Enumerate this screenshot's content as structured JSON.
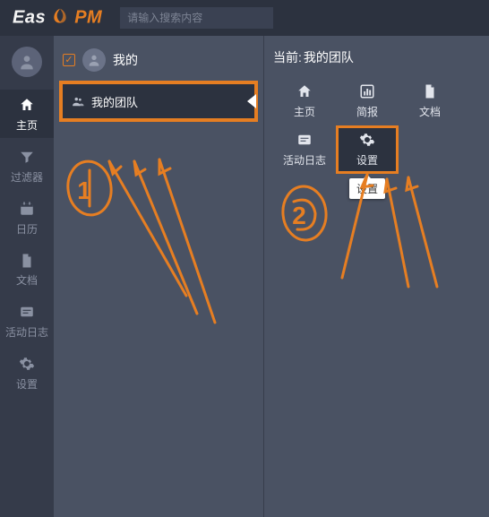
{
  "colors": {
    "accent": "#e67e22"
  },
  "topbar": {
    "logo_text_1": "Eas",
    "logo_text_2": "PM",
    "logo_leaf": "❧"
  },
  "search": {
    "placeholder": "请输入搜索内容"
  },
  "rail": {
    "items": [
      {
        "icon": "home",
        "label": "主页"
      },
      {
        "icon": "filter",
        "label": "过滤器"
      },
      {
        "icon": "calendar",
        "label": "日历"
      },
      {
        "icon": "doc",
        "label": "文档"
      },
      {
        "icon": "log",
        "label": "活动日志"
      },
      {
        "icon": "gear",
        "label": "设置"
      }
    ],
    "active_index": 0
  },
  "mid": {
    "title": "我的",
    "team_item_label": "我的团队"
  },
  "right": {
    "current_prefix": "当前:",
    "current_value": "我的团队",
    "tiles": [
      {
        "icon": "home",
        "label": "主页"
      },
      {
        "icon": "chart",
        "label": "简报"
      },
      {
        "icon": "doc",
        "label": "文档"
      },
      {
        "icon": "log",
        "label": "活动日志"
      },
      {
        "icon": "gear",
        "label": "设置"
      }
    ],
    "highlight_index": 4,
    "tooltip": "设置"
  },
  "annotations": {
    "one": "1",
    "two": "2"
  }
}
